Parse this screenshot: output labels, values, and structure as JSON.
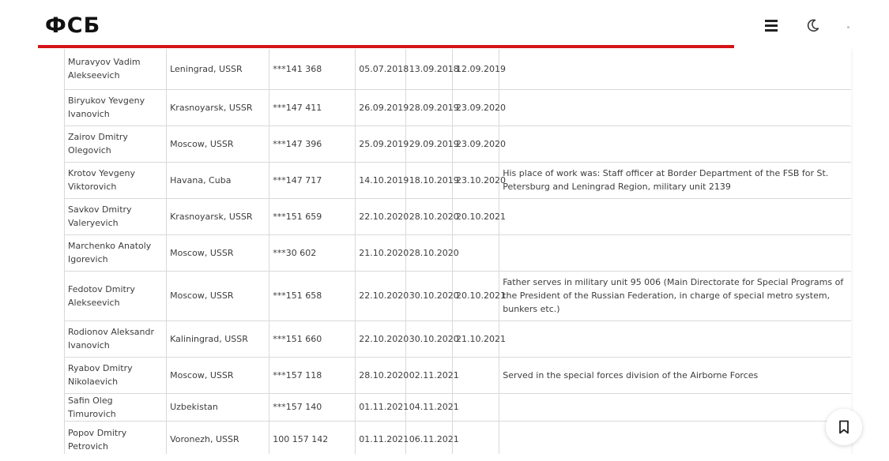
{
  "header": {
    "logo": "ФСБ",
    "menu_icon": "hamburger-menu-icon",
    "theme_icon": "moon-icon",
    "accent_color": "#d51317"
  },
  "table": {
    "rows": [
      {
        "name": "Muravyov Vadim Alekseevich",
        "place": "Leningrad, USSR",
        "number": "***141 368",
        "date1": "05.07.2018",
        "date2": "13.09.2018",
        "date3": "12.09.2019",
        "note": ""
      },
      {
        "name": "Biryukov Yevgeny Ivanovich",
        "place": "Krasnoyarsk, USSR",
        "number": "***147 411",
        "date1": "26.09.2019",
        "date2": "28.09.2019",
        "date3": "23.09.2020",
        "note": ""
      },
      {
        "name": "Zairov Dmitry Olegovich",
        "place": "Moscow, USSR",
        "number": "***147 396",
        "date1": "25.09.2019",
        "date2": "29.09.2019",
        "date3": "23.09.2020",
        "note": ""
      },
      {
        "name": "Krotov Yevgeny Viktorovich",
        "place": "Havana, Cuba",
        "number": "***147 717",
        "date1": "14.10.2019",
        "date2": "18.10.2019",
        "date3": "23.10.2020",
        "note": "His place of work was: Staff officer at Border Department of the FSB for St. Petersburg and Leningrad Region, military unit 2139"
      },
      {
        "name": "Savkov Dmitry Valeryevich",
        "place": "Krasnoyarsk, USSR",
        "number": "***151 659",
        "date1": "22.10.2020",
        "date2": "28.10.2020",
        "date3": "20.10.2021",
        "note": ""
      },
      {
        "name": "Marchenko Anatoly Igorevich",
        "place": "Moscow, USSR",
        "number": "***30 602",
        "date1": "21.10.2020",
        "date2": "28.10.2020",
        "date3": "",
        "note": ""
      },
      {
        "name": "Fedotov Dmitry Alekseevich",
        "place": "Moscow, USSR",
        "number": "***151 658",
        "date1": "22.10.2020",
        "date2": "30.10.2020",
        "date3": "20.10.2021",
        "note": "Father serves in military unit 95 006 (Main Directorate for Special Programs of the President of the Russian Federation, in charge of special metro system, bunkers etc.)"
      },
      {
        "name": "Rodionov Aleksandr Ivanovich",
        "place": "Kaliningrad, USSR",
        "number": "***151 660",
        "date1": "22.10.2020",
        "date2": "30.10.2020",
        "date3": "21.10.2021",
        "note": ""
      },
      {
        "name": "Ryabov Dmitry Nikolaevich",
        "place": "Moscow, USSR",
        "number": "***157 118",
        "date1": "28.10.2020",
        "date2": "02.11.2021",
        "date3": "",
        "note": "Served in the special forces division of the Airborne Forces"
      },
      {
        "name": "Safin Oleg Timurovich",
        "place": "Uzbekistan",
        "number": "***157 140",
        "date1": "01.11.2021",
        "date2": "04.11.2021",
        "date3": "",
        "note": ""
      },
      {
        "name": "Popov Dmitry Petrovich",
        "place": "Voronezh, USSR",
        "number": "100 157 142",
        "date1": "01.11.2021",
        "date2": "06.11.2021",
        "date3": "",
        "note": ""
      }
    ]
  },
  "bookmark_icon": "bookmark-icon"
}
